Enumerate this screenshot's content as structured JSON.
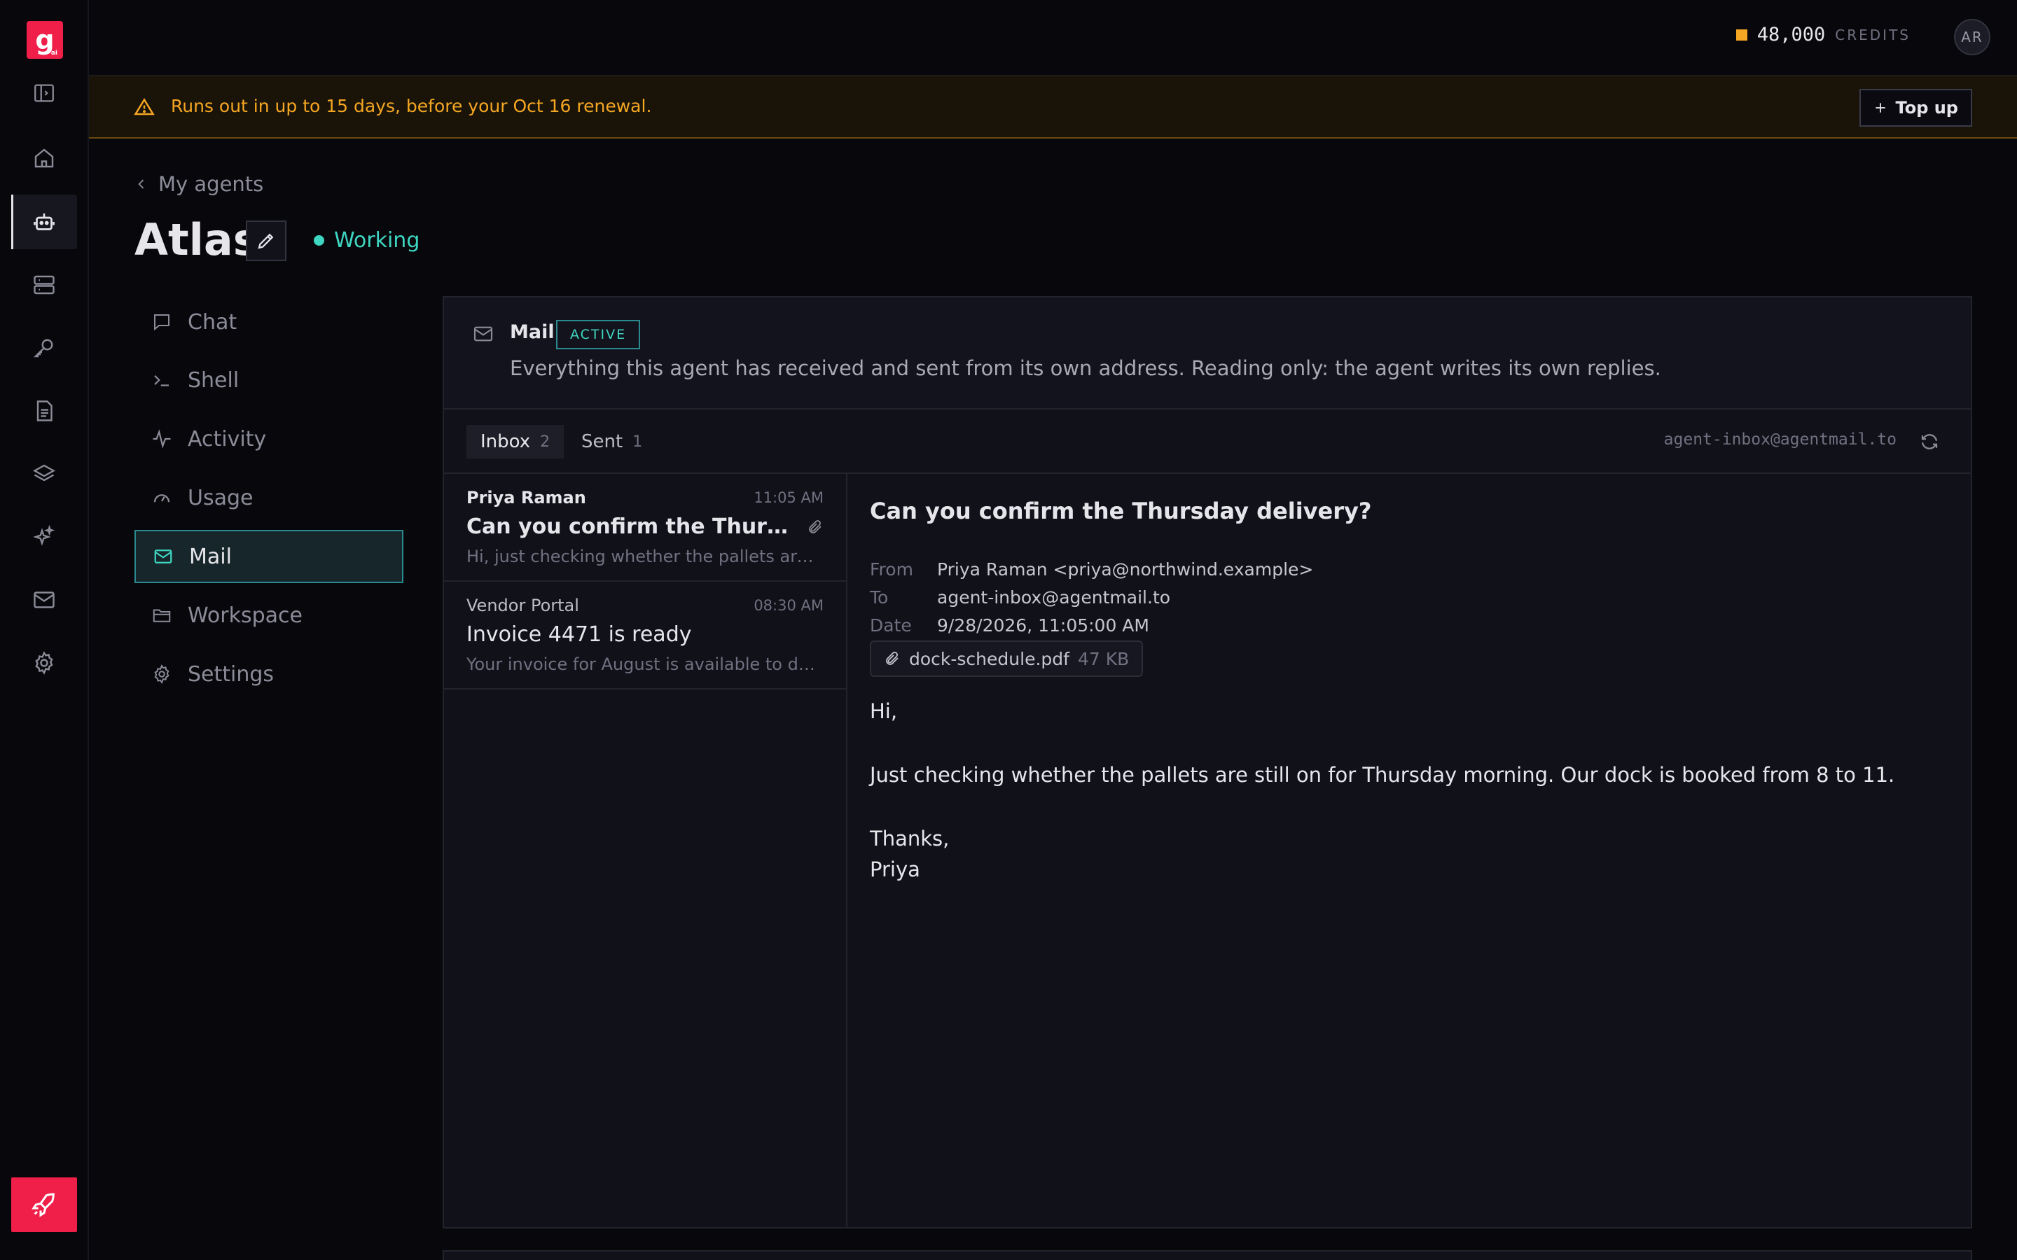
{
  "app": {
    "logo_text": "g",
    "logo_sub": "ai",
    "credits_amount": "48,000",
    "credits_label": "CREDITS",
    "avatar_initials": "AR",
    "accent": "#3fd6c1",
    "warning": "#f5a623",
    "brand": "#ef1f4a"
  },
  "rail": {
    "items": [
      {
        "icon": "sidebar-toggle-icon"
      },
      {
        "icon": "home-icon"
      },
      {
        "icon": "robot-icon",
        "active": true
      },
      {
        "icon": "server-icon"
      },
      {
        "icon": "key-icon"
      },
      {
        "icon": "document-icon"
      },
      {
        "icon": "layers-icon"
      },
      {
        "icon": "sparkles-icon"
      },
      {
        "icon": "mail-icon"
      },
      {
        "icon": "gear-icon"
      }
    ],
    "launch_icon": "rocket-icon"
  },
  "banner": {
    "text": "Runs out in up to 15 days, before your Oct 16 renewal.",
    "topup_label": "Top up"
  },
  "header": {
    "breadcrumb": "My agents",
    "title": "Atlas",
    "status": "Working"
  },
  "nav": {
    "items": [
      {
        "label": "Chat",
        "icon": "chat-icon"
      },
      {
        "label": "Shell",
        "icon": "terminal-icon"
      },
      {
        "label": "Activity",
        "icon": "activity-icon"
      },
      {
        "label": "Usage",
        "icon": "gauge-icon"
      },
      {
        "label": "Mail",
        "icon": "mail-icon",
        "active": true
      },
      {
        "label": "Workspace",
        "icon": "folder-icon"
      },
      {
        "label": "Settings",
        "icon": "gear-icon"
      }
    ]
  },
  "mail": {
    "title": "Mail",
    "badge": "ACTIVE",
    "description": "Everything this agent has received and sent from its own address. Reading only: the agent writes its own replies.",
    "tabs": [
      {
        "label": "Inbox",
        "count": "2",
        "active": true
      },
      {
        "label": "Sent",
        "count": "1"
      }
    ],
    "address": "agent-inbox@agentmail.to",
    "messages": [
      {
        "from": "Priya Raman",
        "time": "11:05 AM",
        "subject": "Can you confirm the Thursday delivery?",
        "preview": "Hi, just checking whether the pallets are still on for Thursday morning.",
        "unread": true,
        "attachment": true
      },
      {
        "from": "Vendor Portal",
        "time": "08:30 AM",
        "subject": "Invoice 4471 is ready",
        "preview": "Your invoice for August is available to download.",
        "unread": false,
        "attachment": false
      }
    ],
    "open": {
      "subject": "Can you confirm the Thursday delivery?",
      "from_label": "From",
      "from": "Priya Raman <priya@northwind.example>",
      "to_label": "To",
      "to": "agent-inbox@agentmail.to",
      "date_label": "Date",
      "date": "9/28/2026, 11:05:00 AM",
      "attachment_name": "dock-schedule.pdf",
      "attachment_size": "47 KB",
      "body": [
        "Hi,",
        "Just checking whether the pallets are still on for Thursday morning. Our dock is booked from 8 to 11.",
        "Thanks,",
        "Priya"
      ]
    }
  }
}
